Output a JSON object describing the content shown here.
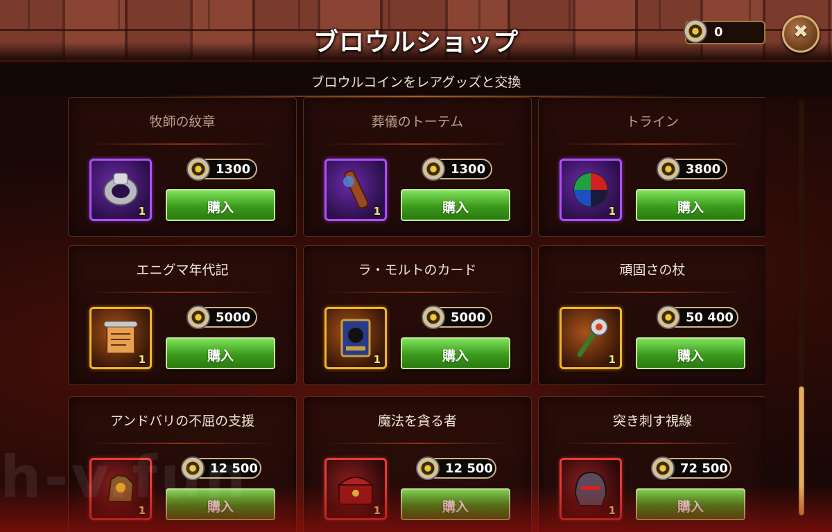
{
  "header": {
    "title": "ブロウルショップ",
    "currency_value": "0",
    "close_symbol": "✖"
  },
  "subtitle": "ブロウルコインをレアグッズと交換",
  "colors": {
    "buy_green": "#3c9a1c",
    "rarity_purple": "#b34dff",
    "rarity_orange": "#f2b624",
    "rarity_red": "#e83a3a"
  },
  "items": [
    {
      "name": "牧師の紋章",
      "price": "1300",
      "qty": "1",
      "rarity": "purple",
      "icon": "ring-icon",
      "buy": "購入"
    },
    {
      "name": "葬儀のトーテム",
      "price": "1300",
      "qty": "1",
      "rarity": "purple",
      "icon": "totem-icon",
      "buy": "購入"
    },
    {
      "name": "トライン",
      "price": "3800",
      "qty": "1",
      "rarity": "purple",
      "icon": "orb-icon",
      "buy": "購入"
    },
    {
      "name": "エニグマ年代記",
      "price": "5000",
      "qty": "1",
      "rarity": "orange",
      "icon": "scroll-icon",
      "buy": "購入"
    },
    {
      "name": "ラ・モルトのカード",
      "price": "5000",
      "qty": "1",
      "rarity": "orange",
      "icon": "card-icon",
      "buy": "購入"
    },
    {
      "name": "頑固さの杖",
      "price": "50 400",
      "qty": "1",
      "rarity": "orange",
      "icon": "staff-icon",
      "buy": "購入"
    },
    {
      "name": "アンドバリの不屈の支援",
      "price": "12 500",
      "qty": "1",
      "rarity": "red",
      "icon": "gauntlet-icon",
      "buy": "購入"
    },
    {
      "name": "魔法を貪る者",
      "price": "12 500",
      "qty": "1",
      "rarity": "red",
      "icon": "chest-icon",
      "buy": "購入"
    },
    {
      "name": "突き刺す視線",
      "price": "72 500",
      "qty": "1",
      "rarity": "red",
      "icon": "helmet-icon",
      "buy": "購入"
    }
  ],
  "watermark": "h-v.fun"
}
